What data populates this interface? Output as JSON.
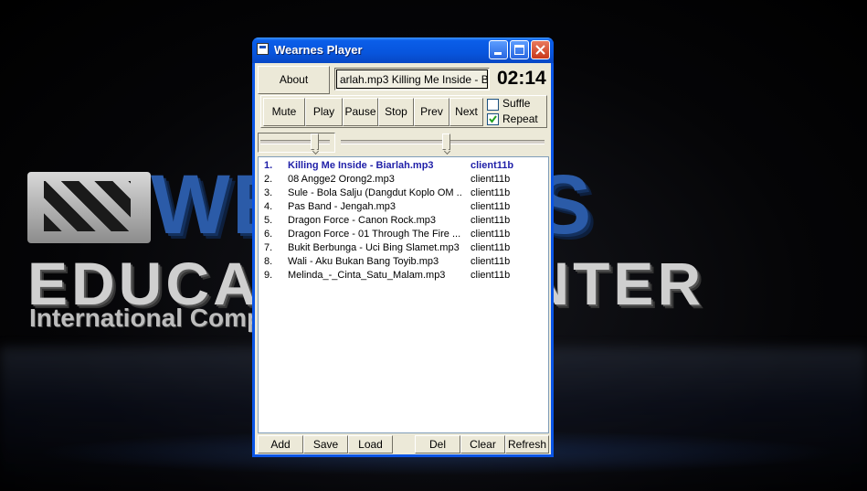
{
  "wallpaper": {
    "big_text": "WEARNES",
    "edu_text": "EDUCATION CENTER",
    "int_text": "International Computer & Business"
  },
  "window": {
    "title": "Wearnes Player"
  },
  "toolbar": {
    "about_label": "About",
    "now_playing": "arlah.mp3    Killing Me Inside - Bi",
    "time": "02:14"
  },
  "controls": {
    "mute": "Mute",
    "play": "Play",
    "pause": "Pause",
    "stop": "Stop",
    "prev": "Prev",
    "next": "Next",
    "shuffle_label": "Suffle",
    "shuffle_checked": false,
    "repeat_label": "Repeat",
    "repeat_checked": true
  },
  "sliders": {
    "volume_level": 0.82,
    "position_level": 0.52
  },
  "playlist": [
    {
      "num": "1.",
      "name": "Killing Me Inside - Biarlah.mp3",
      "owner": "client11b",
      "active": true
    },
    {
      "num": "2.",
      "name": "08 Angge2 Orong2.mp3",
      "owner": "client11b",
      "active": false
    },
    {
      "num": "3.",
      "name": "Sule - Bola Salju (Dangdut Koplo OM ...",
      "owner": "client11b",
      "active": false
    },
    {
      "num": "4.",
      "name": "Pas Band - Jengah.mp3",
      "owner": "client11b",
      "active": false
    },
    {
      "num": "5.",
      "name": "Dragon Force - Canon Rock.mp3",
      "owner": "client11b",
      "active": false
    },
    {
      "num": "6.",
      "name": "Dragon Force - 01 Through The Fire ...",
      "owner": "client11b",
      "active": false
    },
    {
      "num": "7.",
      "name": "Bukit Berbunga - Uci Bing Slamet.mp3",
      "owner": "client11b",
      "active": false
    },
    {
      "num": "8.",
      "name": "Wali - Aku Bukan Bang Toyib.mp3",
      "owner": "client11b",
      "active": false
    },
    {
      "num": "9.",
      "name": "Melinda_-_Cinta_Satu_Malam.mp3",
      "owner": "client11b",
      "active": false
    }
  ],
  "bottom": {
    "add": "Add",
    "save": "Save",
    "load": "Load",
    "del": "Del",
    "clear": "Clear",
    "refresh": "Refresh"
  }
}
